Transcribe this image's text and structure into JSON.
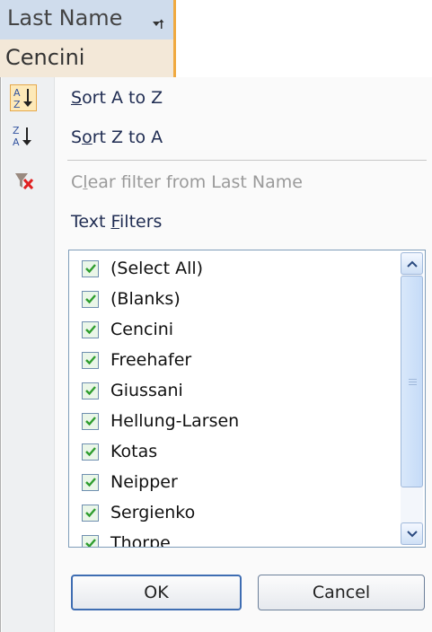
{
  "header": {
    "column_title": "Last Name"
  },
  "cell": {
    "value": "Cencini"
  },
  "menu": {
    "sort_az": {
      "prefix": "",
      "accel": "S",
      "rest": "ort A to Z"
    },
    "sort_za": {
      "prefix": "S",
      "accel": "o",
      "rest": "rt Z to A"
    },
    "clear_filter": {
      "prefix": "C",
      "accel": "l",
      "rest": "ear filter from Last Name"
    },
    "text_filters": {
      "prefix": "Text ",
      "accel": "F",
      "rest": "ilters"
    }
  },
  "filter_list": {
    "items": [
      {
        "label": "(Select All)",
        "checked": true
      },
      {
        "label": "(Blanks)",
        "checked": true
      },
      {
        "label": "Cencini",
        "checked": true
      },
      {
        "label": "Freehafer",
        "checked": true
      },
      {
        "label": "Giussani",
        "checked": true
      },
      {
        "label": "Hellung-Larsen",
        "checked": true
      },
      {
        "label": "Kotas",
        "checked": true
      },
      {
        "label": "Neipper",
        "checked": true
      },
      {
        "label": "Sergienko",
        "checked": true
      },
      {
        "label": "Thorpe",
        "checked": true
      }
    ]
  },
  "buttons": {
    "ok": "OK",
    "cancel": "Cancel"
  },
  "icons": {
    "sort_az": "sort-ascending-icon",
    "sort_za": "sort-descending-icon",
    "clear_filter": "clear-filter-icon",
    "filter_dropdown": "filter-dropdown-icon"
  },
  "colors": {
    "checkmark": "#2e9d2e",
    "accent_border": "#f0a93f",
    "header_bg": "#cfdcec"
  }
}
